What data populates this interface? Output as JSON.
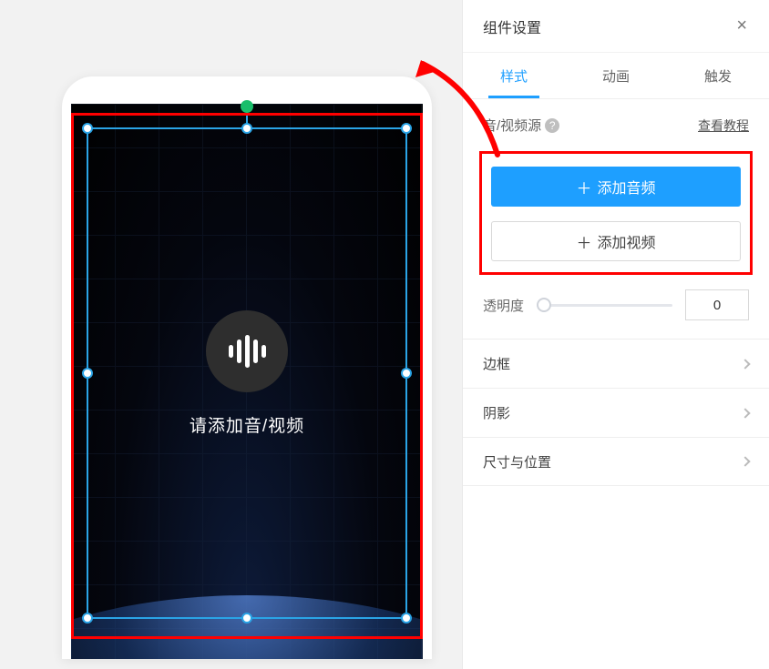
{
  "panel": {
    "title": "组件设置",
    "tabs": {
      "style": "样式",
      "animation": "动画",
      "trigger": "触发"
    },
    "source_label": "音/视频源",
    "tutorial_link": "查看教程",
    "btn_add_audio": "添加音频",
    "btn_add_video": "添加视频",
    "opacity_label": "透明度",
    "opacity_value": "0",
    "collapse": {
      "border": "边框",
      "shadow": "阴影",
      "size_pos": "尺寸与位置"
    }
  },
  "canvas": {
    "placeholder_text": "请添加音/视频"
  }
}
